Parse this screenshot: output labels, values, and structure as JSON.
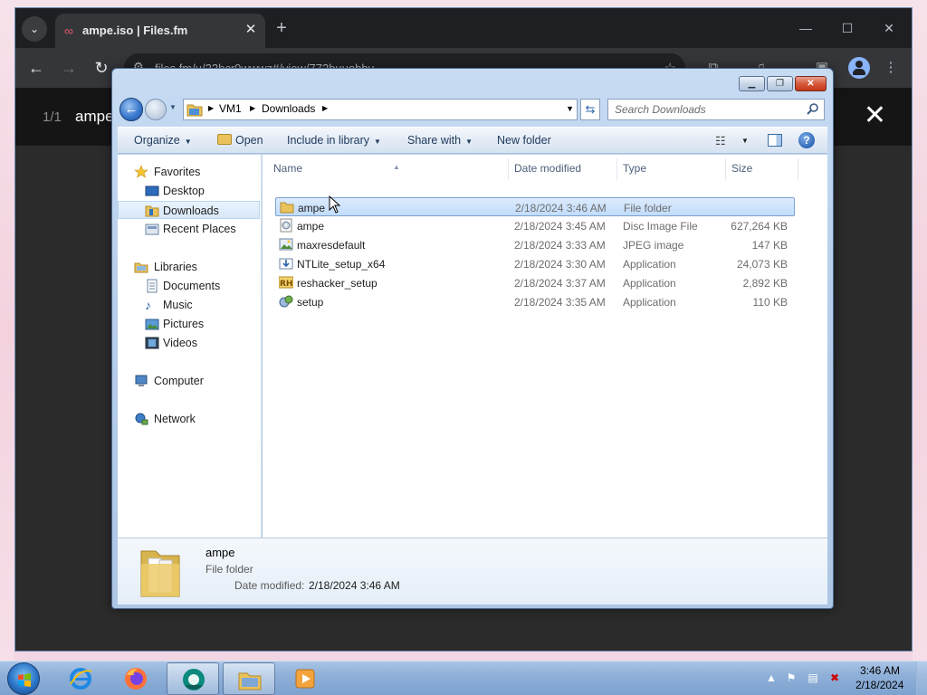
{
  "browser": {
    "tab_title": "ampe.iso | Files.fm",
    "url": "files.fm/u/22bcr9wwwz#/view/772buuobby",
    "viewer_count": "1/1",
    "viewer_filename": "ampe"
  },
  "explorer": {
    "breadcrumb": [
      "VM1",
      "Downloads"
    ],
    "search_placeholder": "Search Downloads",
    "commands": {
      "organize": "Organize",
      "open": "Open",
      "include_in_library": "Include in library",
      "share_with": "Share with",
      "new_folder": "New folder"
    },
    "nav": {
      "favorites": "Favorites",
      "desktop": "Desktop",
      "downloads": "Downloads",
      "recent_places": "Recent Places",
      "libraries": "Libraries",
      "documents": "Documents",
      "music": "Music",
      "pictures": "Pictures",
      "videos": "Videos",
      "computer": "Computer",
      "network": "Network"
    },
    "columns": {
      "name": "Name",
      "date_modified": "Date modified",
      "type": "Type",
      "size": "Size"
    },
    "files": [
      {
        "name": "ampe",
        "date": "2/18/2024 3:46 AM",
        "type": "File folder",
        "size": "",
        "icon": "folder-icon"
      },
      {
        "name": "ampe",
        "date": "2/18/2024 3:45 AM",
        "type": "Disc Image File",
        "size": "627,264 KB",
        "icon": "disc-image-icon"
      },
      {
        "name": "maxresdefault",
        "date": "2/18/2024 3:33 AM",
        "type": "JPEG image",
        "size": "147 KB",
        "icon": "image-file-icon"
      },
      {
        "name": "NTLite_setup_x64",
        "date": "2/18/2024 3:30 AM",
        "type": "Application",
        "size": "24,073 KB",
        "icon": "installer-icon"
      },
      {
        "name": "reshacker_setup",
        "date": "2/18/2024 3:37 AM",
        "type": "Application",
        "size": "2,892 KB",
        "icon": "reshacker-icon"
      },
      {
        "name": "setup",
        "date": "2/18/2024 3:35 AM",
        "type": "Application",
        "size": "110 KB",
        "icon": "setup-icon"
      }
    ],
    "details": {
      "name": "ampe",
      "type": "File folder",
      "date_label": "Date modified:",
      "date_value": "2/18/2024 3:46 AM"
    }
  },
  "taskbar": {
    "time": "3:46 AM",
    "date": "2/18/2024"
  },
  "colors": {
    "accent": "#3b7ad0",
    "selection": "#c1dcfc",
    "taskbar": "#8fb0d8"
  }
}
